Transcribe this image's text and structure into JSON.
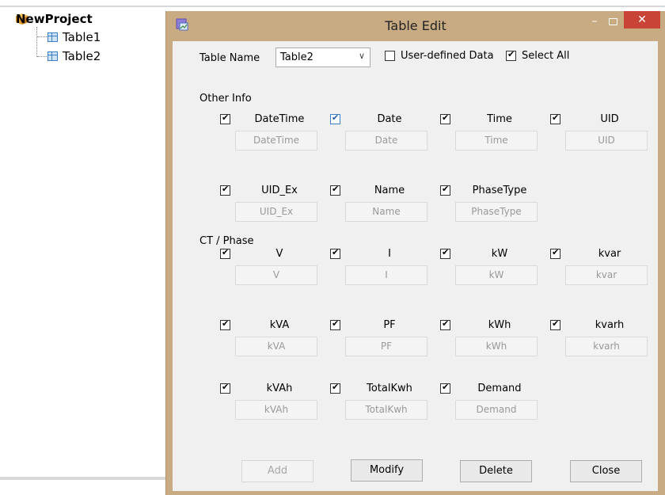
{
  "tree": {
    "root": "NewProject",
    "items": [
      "Table1",
      "Table2"
    ]
  },
  "dialog": {
    "title": "Table Edit",
    "minimize": "–",
    "close": "✕",
    "table_name_label": "Table Name",
    "table_name_value": "Table2",
    "combo_arrow": "∨",
    "user_defined": {
      "label": "User-defined Data",
      "checked": false
    },
    "select_all": {
      "label": "Select All",
      "checked": true
    },
    "sections": {
      "other_info": "Other Info",
      "ct_phase": "CT / Phase"
    },
    "fields": [
      {
        "label": "DateTime",
        "value": "DateTime",
        "checked": true
      },
      {
        "label": "Date",
        "value": "Date",
        "checked": true
      },
      {
        "label": "Time",
        "value": "Time",
        "checked": true
      },
      {
        "label": "UID",
        "value": "UID",
        "checked": true
      },
      {
        "label": "UID_Ex",
        "value": "UID_Ex",
        "checked": true
      },
      {
        "label": "Name",
        "value": "Name",
        "checked": true
      },
      {
        "label": "PhaseType",
        "value": "PhaseType",
        "checked": true
      },
      {
        "label": "V",
        "value": "V",
        "checked": true
      },
      {
        "label": "I",
        "value": "I",
        "checked": true
      },
      {
        "label": "kW",
        "value": "kW",
        "checked": true
      },
      {
        "label": "kvar",
        "value": "kvar",
        "checked": true
      },
      {
        "label": "kVA",
        "value": "kVA",
        "checked": true
      },
      {
        "label": "PF",
        "value": "PF",
        "checked": true
      },
      {
        "label": "kWh",
        "value": "kWh",
        "checked": true
      },
      {
        "label": "kvarh",
        "value": "kvarh",
        "checked": true
      },
      {
        "label": "kVAh",
        "value": "kVAh",
        "checked": true
      },
      {
        "label": "TotalKwh",
        "value": "TotalKwh",
        "checked": true
      },
      {
        "label": "Demand",
        "value": "Demand",
        "checked": true
      }
    ],
    "buttons": {
      "add": "Add",
      "modify": "Modify",
      "delete": "Delete",
      "close": "Close"
    }
  }
}
